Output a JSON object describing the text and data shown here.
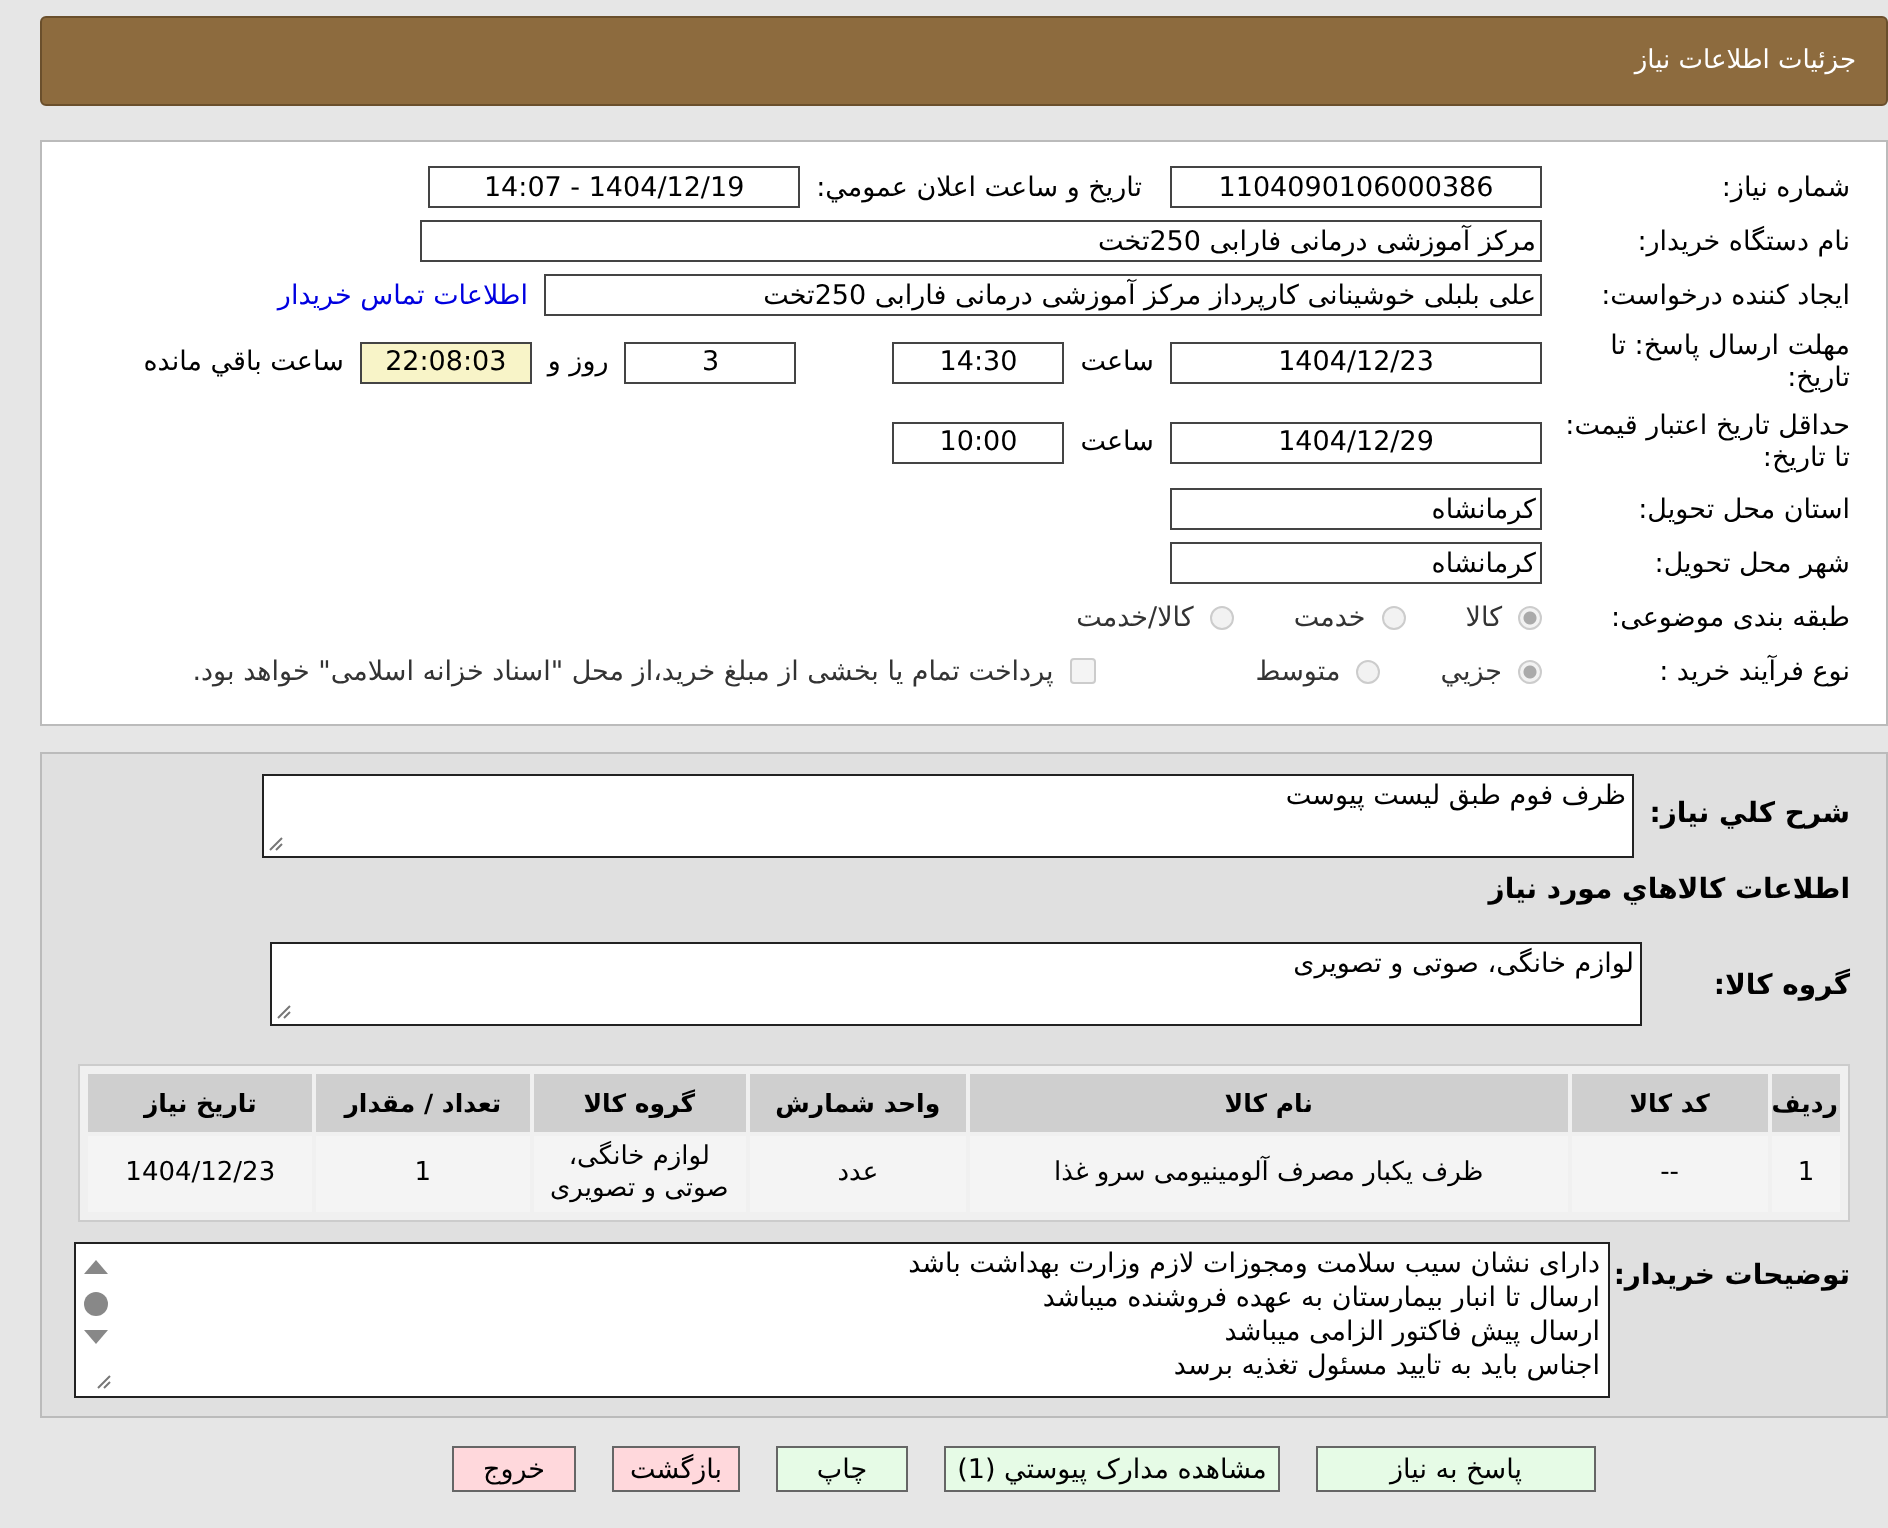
{
  "header": {
    "title": "جزئیات اطلاعات نیاز"
  },
  "need_number": {
    "label": "شماره نیاز:",
    "value": "1104090106000386"
  },
  "announce": {
    "label": "تاریخ و ساعت اعلان عمومي:",
    "value": "1404/12/19 - 14:07"
  },
  "buyer": {
    "label": "نام دستگاه خریدار:",
    "value": "مرکز آموزشی  درمانی فارابی 250تخت"
  },
  "requester": {
    "label": "ایجاد کننده درخواست:",
    "value": "علی بلبلی خوشینانی کارپرداز مرکز آموزشی  درمانی فارابی 250تخت",
    "link": "اطلاعات تماس خریدار"
  },
  "reply_deadline": {
    "label": "مهلت ارسال پاسخ: تا تاریخ:",
    "date": "1404/12/23",
    "time_label": "ساعت",
    "time": "14:30",
    "days": "3",
    "days_label": "روز و",
    "remaining": "22:08:03",
    "remaining_label": "ساعت باقي مانده"
  },
  "price_validity": {
    "label": "حداقل تاریخ اعتبار قیمت: تا تاریخ:",
    "date": "1404/12/29",
    "time_label": "ساعت",
    "time": "10:00"
  },
  "province": {
    "label": "استان محل تحویل:",
    "value": "کرمانشاه"
  },
  "city": {
    "label": "شهر محل تحویل:",
    "value": "کرمانشاه"
  },
  "category": {
    "label": "طبقه بندی موضوعی:",
    "options": [
      {
        "label": "کالا",
        "selected": true
      },
      {
        "label": "خدمت",
        "selected": false
      },
      {
        "label": "کالا/خدمت",
        "selected": false
      }
    ]
  },
  "process": {
    "label": "نوع فرآیند خرید :",
    "options": [
      {
        "label": "جزيي",
        "selected": true
      },
      {
        "label": "متوسط",
        "selected": false
      }
    ],
    "payment": {
      "label": "پرداخت تمام یا بخشی از مبلغ خرید،از محل \"اسناد خزانه اسلامی\" خواهد بود.",
      "checked": false
    }
  },
  "summary": {
    "label": "شرح کلي نیاز:",
    "value": "ظرف فوم طبق لیست پیوست"
  },
  "goods_heading": "اطلاعات کالاهاي مورد نیاز",
  "goods_group": {
    "label": "گروه کالا:",
    "value": "لوازم خانگی، صوتی و تصویری"
  },
  "table": {
    "columns": [
      "ردیف",
      "کد کالا",
      "نام کالا",
      "واحد شمارش",
      "گروه کالا",
      "تعداد / مقدار",
      "تاریخ نیاز"
    ],
    "rows": [
      [
        "1",
        "--",
        "ظرف یکبار مصرف آلومینیومی سرو غذا",
        "عدد",
        "لوازم خانگی، صوتی و تصویری",
        "1",
        "1404/12/23"
      ]
    ]
  },
  "notes": {
    "label": "توضیحات خریدار:",
    "lines": [
      "دارای نشان سیب سلامت ومجوزات لازم وزارت بهداشت  باشد",
      "ارسال تا انبار بیمارستان به عهده فروشنده میباشد",
      "ارسال پیش فاکتور الزامی میباشد",
      "اجناس باید به تایید مسئول تغذیه برسد"
    ]
  },
  "buttons": [
    {
      "label": "پاسخ به نیاز",
      "kind": "action"
    },
    {
      "label": "مشاهده مدارک پیوستي (1)",
      "kind": "action"
    },
    {
      "label": "چاپ",
      "kind": "action"
    },
    {
      "label": "بازگشت",
      "kind": "exit"
    },
    {
      "label": "خروج",
      "kind": "exit"
    }
  ]
}
